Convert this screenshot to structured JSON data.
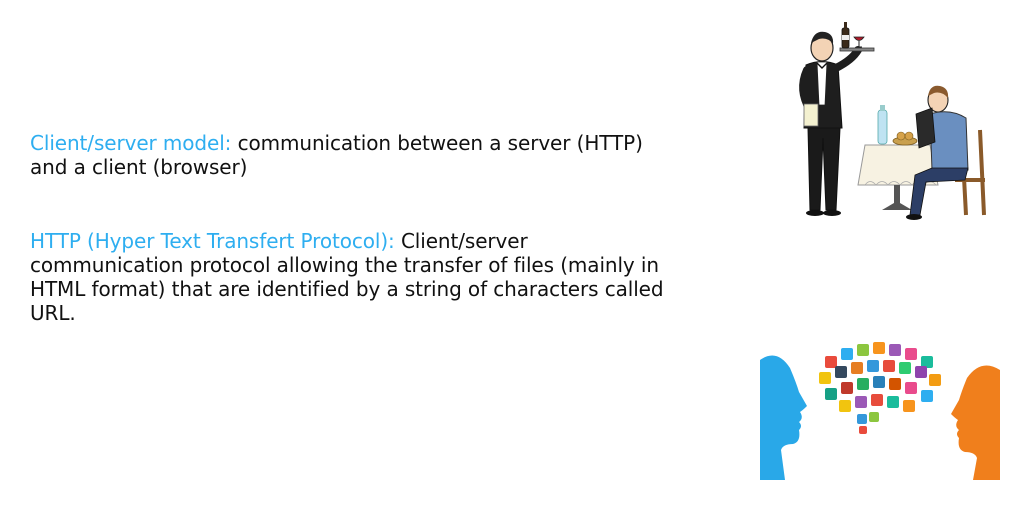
{
  "paragraphs": [
    {
      "term": "Client/server model:",
      "text": "communication between a server (HTTP) and a client (browser)"
    },
    {
      "term": "HTTP (Hyper Text Transfert Protocol):",
      "text": "Client/server communication protocol allowing the transfer of files (mainly in HTML format) that are identified by a string of characters called URL."
    }
  ],
  "colors": {
    "term": "#2eaef0",
    "text": "#111111",
    "left_head": "#29a8e8",
    "right_head": "#f07f1c"
  },
  "illustrations": {
    "top": "waiter-serving-diner-illustration",
    "bottom": "speech-bubble-icons-illustration"
  }
}
